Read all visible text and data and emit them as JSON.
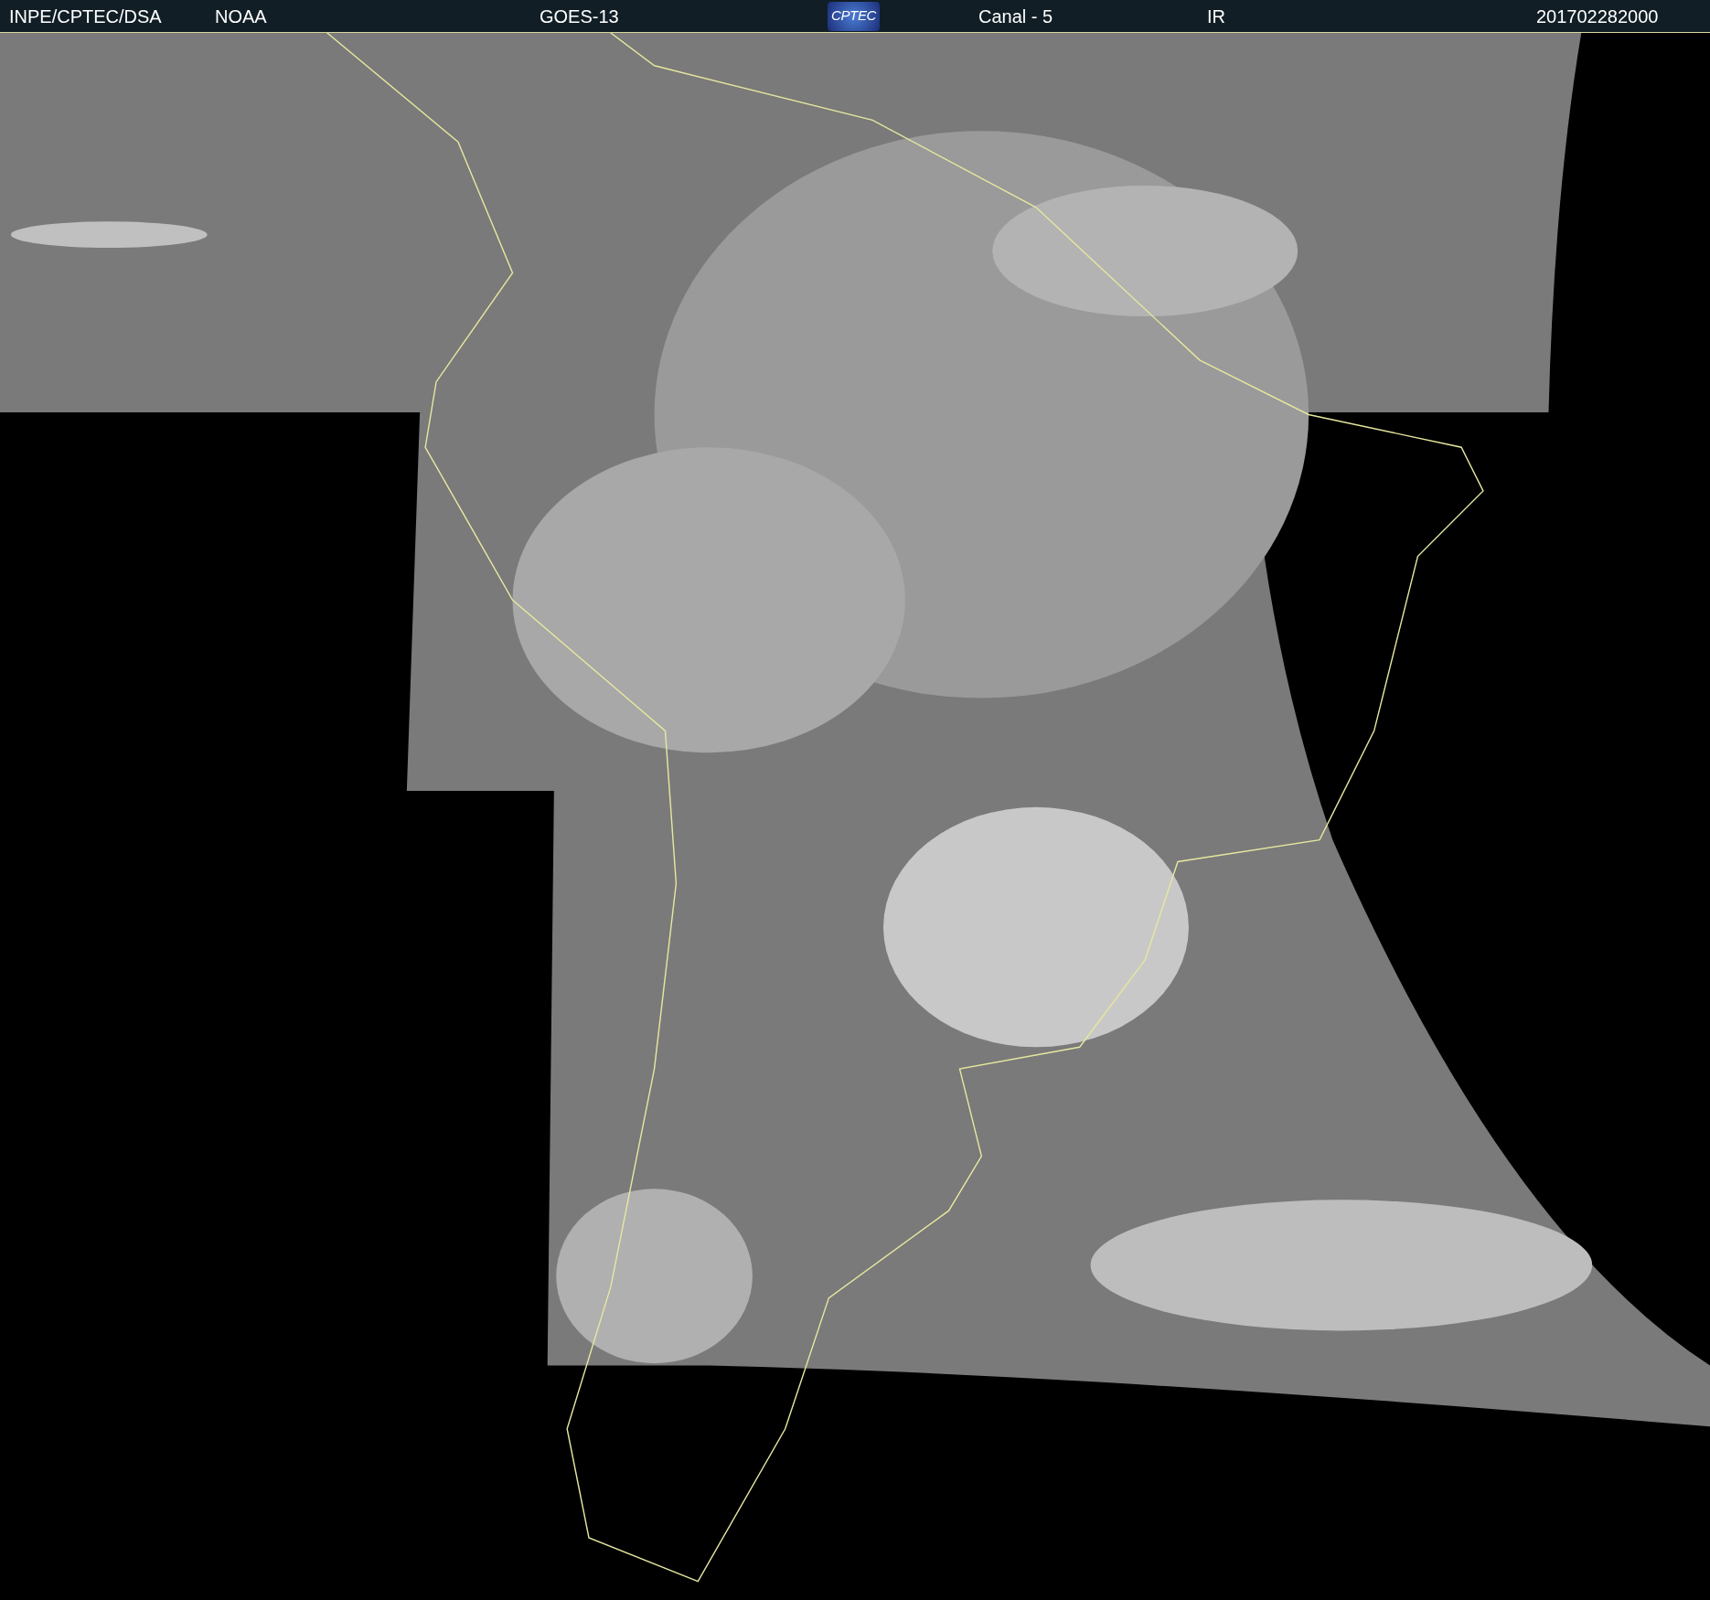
{
  "header": {
    "items": [
      {
        "kind": "text",
        "text": "INPE/CPTEC/DSA"
      },
      {
        "kind": "text",
        "text": "NOAA"
      },
      {
        "kind": "text",
        "text": "GOES-13"
      },
      {
        "kind": "logo",
        "text": "CPTEC"
      },
      {
        "kind": "text",
        "text": "Canal - 5"
      },
      {
        "kind": "text",
        "text": "IR"
      },
      {
        "kind": "text",
        "text": "201702282000"
      }
    ]
  }
}
